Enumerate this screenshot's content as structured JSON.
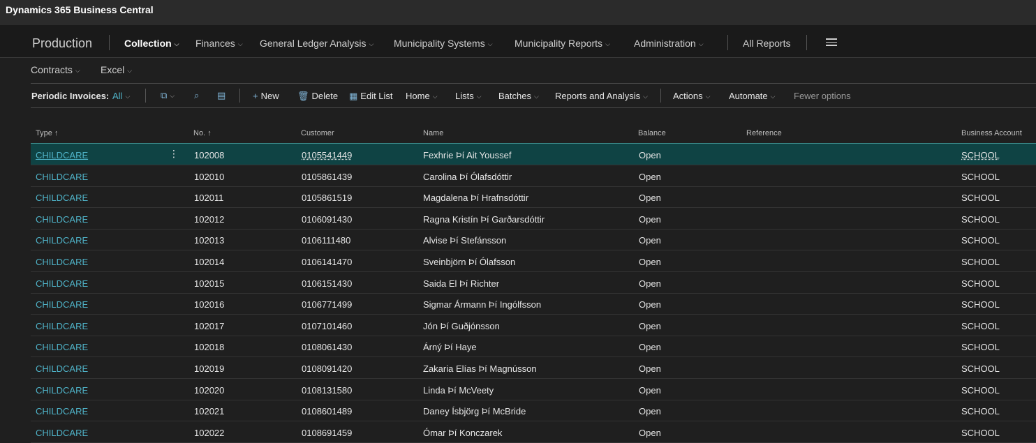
{
  "app": {
    "title": "Dynamics 365 Business Central"
  },
  "nav": {
    "company": "Production",
    "items": [
      {
        "label": "Collection",
        "active": true,
        "chevron": true
      },
      {
        "label": "Finances",
        "active": false,
        "chevron": true
      },
      {
        "label": "General Ledger Analysis",
        "active": false,
        "chevron": true
      },
      {
        "label": "Municipality Systems",
        "active": false,
        "chevron": true
      },
      {
        "label": "Municipality Reports",
        "active": false,
        "chevron": true
      },
      {
        "label": "Administration",
        "active": false,
        "chevron": true
      }
    ],
    "all_reports": "All Reports",
    "menu_icon": "hamburger-icon"
  },
  "subnav": {
    "contracts": "Contracts",
    "excel": "Excel"
  },
  "actions": {
    "page_label": "Periodic Invoices:",
    "view_filter": "All",
    "new": "New",
    "delete": "Delete",
    "edit_list": "Edit List",
    "home": "Home",
    "lists": "Lists",
    "batches": "Batches",
    "reports": "Reports and Analysis",
    "actions": "Actions",
    "automate": "Automate",
    "fewer": "Fewer options"
  },
  "table": {
    "columns": [
      "Type",
      "No.",
      "Customer",
      "Name",
      "Balance",
      "Reference",
      "Business Account"
    ],
    "rows": [
      {
        "type": "CHILDCARE",
        "no": "102008",
        "customer": "0105541449",
        "name": "Fexhrie Þí Ait Youssef",
        "balance": "Open",
        "reference": "",
        "account": "SCHOOL",
        "selected": true
      },
      {
        "type": "CHILDCARE",
        "no": "102010",
        "customer": "0105861439",
        "name": "Carolina Þí Ólafsdóttir",
        "balance": "Open",
        "reference": "",
        "account": "SCHOOL"
      },
      {
        "type": "CHILDCARE",
        "no": "102011",
        "customer": "0105861519",
        "name": "Magdalena Þí Hrafnsdóttir",
        "balance": "Open",
        "reference": "",
        "account": "SCHOOL"
      },
      {
        "type": "CHILDCARE",
        "no": "102012",
        "customer": "0106091430",
        "name": "Ragna Kristín Þí Garðarsdóttir",
        "balance": "Open",
        "reference": "",
        "account": "SCHOOL"
      },
      {
        "type": "CHILDCARE",
        "no": "102013",
        "customer": "0106111480",
        "name": "Alvise Þí Stefánsson",
        "balance": "Open",
        "reference": "",
        "account": "SCHOOL"
      },
      {
        "type": "CHILDCARE",
        "no": "102014",
        "customer": "0106141470",
        "name": "Sveinbjörn Þí Ólafsson",
        "balance": "Open",
        "reference": "",
        "account": "SCHOOL"
      },
      {
        "type": "CHILDCARE",
        "no": "102015",
        "customer": "0106151430",
        "name": "Saida El Þí Richter",
        "balance": "Open",
        "reference": "",
        "account": "SCHOOL"
      },
      {
        "type": "CHILDCARE",
        "no": "102016",
        "customer": "0106771499",
        "name": "Sigmar Ármann Þí Ingólfsson",
        "balance": "Open",
        "reference": "",
        "account": "SCHOOL"
      },
      {
        "type": "CHILDCARE",
        "no": "102017",
        "customer": "0107101460",
        "name": "Jón Þí Guðjónsson",
        "balance": "Open",
        "reference": "",
        "account": "SCHOOL"
      },
      {
        "type": "CHILDCARE",
        "no": "102018",
        "customer": "0108061430",
        "name": "Árný Þí Haye",
        "balance": "Open",
        "reference": "",
        "account": "SCHOOL"
      },
      {
        "type": "CHILDCARE",
        "no": "102019",
        "customer": "0108091420",
        "name": "Zakaria Elías Þí Magnússon",
        "balance": "Open",
        "reference": "",
        "account": "SCHOOL"
      },
      {
        "type": "CHILDCARE",
        "no": "102020",
        "customer": "0108131580",
        "name": "Linda Þí McVeety",
        "balance": "Open",
        "reference": "",
        "account": "SCHOOL"
      },
      {
        "type": "CHILDCARE",
        "no": "102021",
        "customer": "0108601489",
        "name": "Daney Ísbjörg Þí McBride",
        "balance": "Open",
        "reference": "",
        "account": "SCHOOL"
      },
      {
        "type": "CHILDCARE",
        "no": "102022",
        "customer": "0108691459",
        "name": "Ómar Þí Konczarek",
        "balance": "Open",
        "reference": "",
        "account": "SCHOOL"
      }
    ]
  },
  "colors": {
    "accent": "#4fb3c8",
    "selected_row": "#0f4344",
    "background": "#1f1f1f"
  }
}
